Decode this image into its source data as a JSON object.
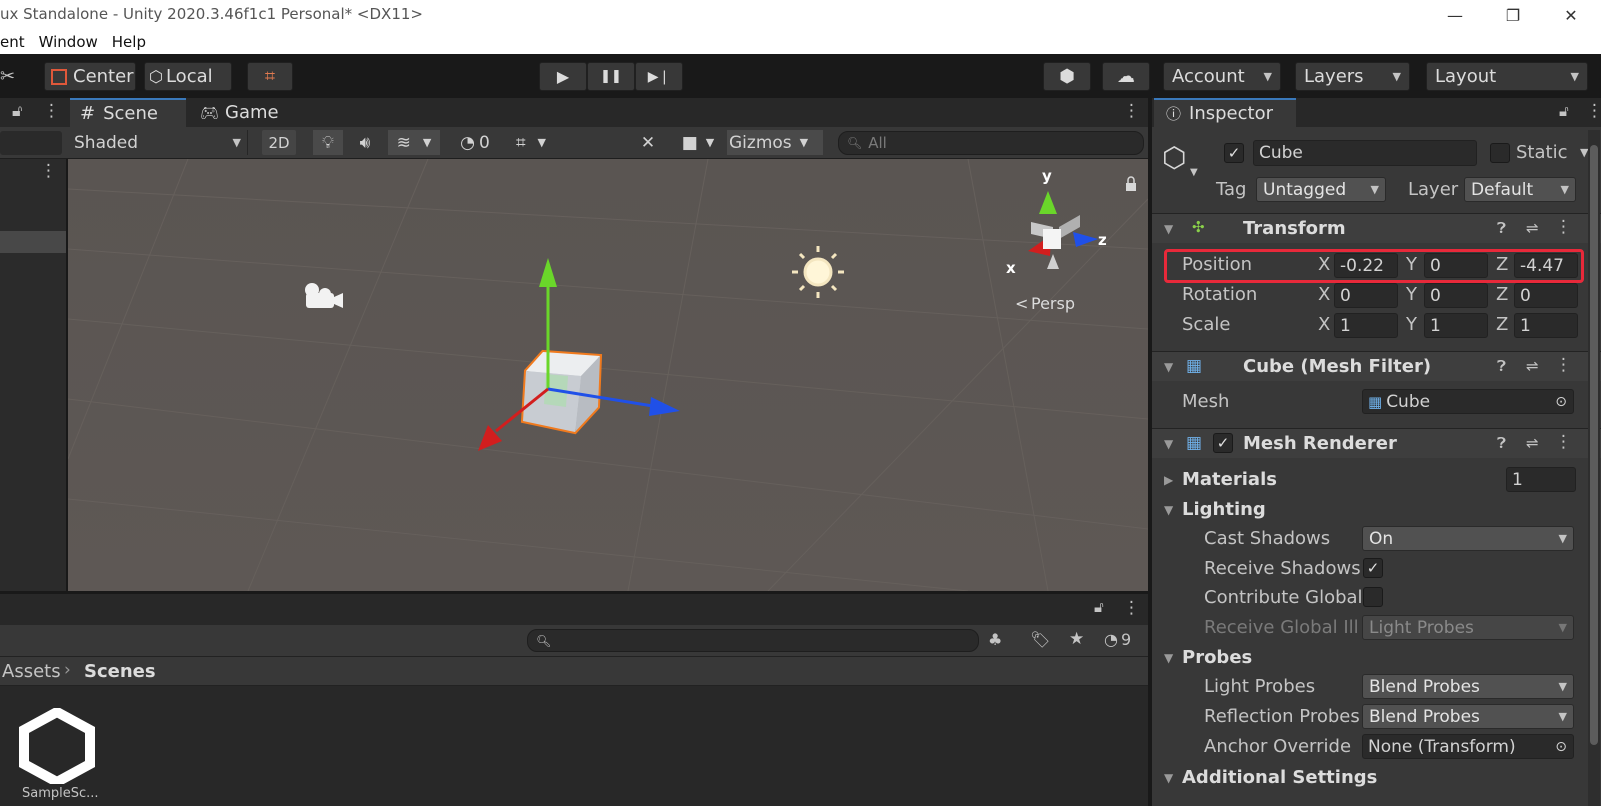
{
  "window": {
    "title": "ux Standalone - Unity 2020.3.46f1c1 Personal* <DX11>",
    "min_icon": "minimize-icon",
    "max_icon": "restore-icon",
    "close_icon": "close-icon",
    "min_glyph": "—",
    "max_glyph": "❐",
    "close_glyph": "✕"
  },
  "menu": [
    "ent",
    "Window",
    "Help"
  ],
  "toolbar": {
    "center_label": "Center",
    "local_label": "Local",
    "play_glyph": "▶",
    "pause_glyph": "❚❚",
    "step_glyph": "▶❘",
    "account_label": "Account",
    "layers_label": "Layers",
    "layout_label": "Layout"
  },
  "scene": {
    "tab_scene": "Scene",
    "tab_game": "Game",
    "shading_mode": "Shaded",
    "btn_2d": "2D",
    "hidden_count": "0",
    "gizmos_label": "Gizmos",
    "search_placeholder": "All",
    "persp_label": "Persp",
    "axis_x": "x",
    "axis_y": "y",
    "axis_z": "z"
  },
  "project": {
    "breadcrumb": [
      "Assets",
      "Scenes"
    ],
    "hidden_count": "9",
    "asset_label": "SampleSc..."
  },
  "inspector": {
    "tab_label": "Inspector",
    "object_name": "Cube",
    "object_active": true,
    "static_label": "Static",
    "tag_label": "Tag",
    "tag_value": "Untagged",
    "layer_label": "Layer",
    "layer_value": "Default",
    "transform": {
      "title": "Transform",
      "position": {
        "label": "Position",
        "x": "-0.22",
        "y": "0",
        "z": "-4.47"
      },
      "rotation": {
        "label": "Rotation",
        "x": "0",
        "y": "0",
        "z": "0"
      },
      "scale": {
        "label": "Scale",
        "x": "1",
        "y": "1",
        "z": "1"
      }
    },
    "mesh_filter": {
      "title": "Cube (Mesh Filter)",
      "mesh_label": "Mesh",
      "mesh_value": "Cube"
    },
    "mesh_renderer": {
      "title": "Mesh Renderer",
      "materials_label": "Materials",
      "materials_count": "1",
      "lighting_label": "Lighting",
      "cast_shadows_label": "Cast Shadows",
      "cast_shadows_value": "On",
      "receive_shadows_label": "Receive Shadows",
      "contribute_gi_label": "Contribute Global",
      "receive_gi_label": "Receive Global Illu",
      "receive_gi_value": "Light Probes",
      "probes_label": "Probes",
      "light_probes_label": "Light Probes",
      "light_probes_value": "Blend Probes",
      "reflection_probes_label": "Reflection Probes",
      "reflection_probes_value": "Blend Probes",
      "anchor_override_label": "Anchor Override",
      "anchor_override_value": "None (Transform)",
      "additional_settings_label": "Additional Settings"
    }
  },
  "colors": {
    "highlight": "#e8293a",
    "axis_x": "#d21e1e",
    "axis_y": "#6ad62a",
    "axis_z": "#2050e8",
    "selection_outline": "#f08a2a"
  }
}
